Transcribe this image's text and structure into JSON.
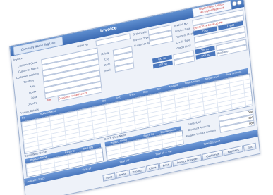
{
  "window": {
    "title": "Invoice",
    "app_name": "Company Name Tag Line"
  },
  "company": {
    "line1": "Organization Limited",
    "line2": "All Rights Reserved"
  },
  "header_fields": {
    "invoice_label": "Invoice",
    "order_no": "Order No",
    "order_date": "Order Date",
    "invoice_type": "Invoice Type",
    "customer_type": "Customer Type",
    "invoice_no": "Invoice No",
    "invoice_date": "Invoice Date",
    "invoice_date_value": "04/25/2014 03:16:20 PM",
    "payment_mode": "Payment Mode",
    "credit_type": "Credit Type",
    "credit_limit": "Credit Limit",
    "cash_label": "Cash",
    "credit_label": "Credit"
  },
  "customer": {
    "customer_code": "Customer Code",
    "customer_name": "Customer Name",
    "customer_address": "Customer Address",
    "territory": "Territory",
    "area": "Area",
    "route": "Route",
    "zone": "Zone",
    "country": "Country",
    "country_code": "INR",
    "country_value": "Customer Name Product",
    "mobile": "Mobile",
    "city": "City",
    "state": "State",
    "email": "Email"
  },
  "boxes": {
    "vat_no": "VAT No",
    "cst_no": "CST No",
    "tin_no": "TIN No",
    "pan_no": "PAN No",
    "pan_value": "Pen Notes"
  },
  "products": {
    "section_label": "Product Details",
    "columns": [
      "No",
      "Product Name",
      "Qty",
      "Unit",
      "Price",
      "Disc.",
      "Tax",
      "Amount",
      "Total Amount",
      "Net Amount",
      "Total Amount"
    ]
  },
  "sub_grids": {
    "left_title": "Detail Wise Name",
    "right_title": "Batch Wise Name",
    "left_columns": [
      "Product Name",
      "Batch No",
      "Total Qty"
    ],
    "right_columns": [
      "Product Name",
      "Batch No",
      "Total Amount"
    ]
  },
  "totals": {
    "gross": "Gross Total",
    "discount": "Discount Amount",
    "pay": "Payable Invoice Amount",
    "value": "000"
  },
  "footer_strip": {
    "available_stock": "Available Stock",
    "total_sp": "Total SP",
    "total_vat": "Total Vat",
    "total_sp_vat": "Total SP + Vat",
    "total_discount": "Total Discount"
  },
  "buttons": [
    "Save",
    "Clear",
    "Reports",
    "Close",
    "Print",
    "Invoice Preview",
    "Customer",
    "Payment",
    "Exit"
  ]
}
